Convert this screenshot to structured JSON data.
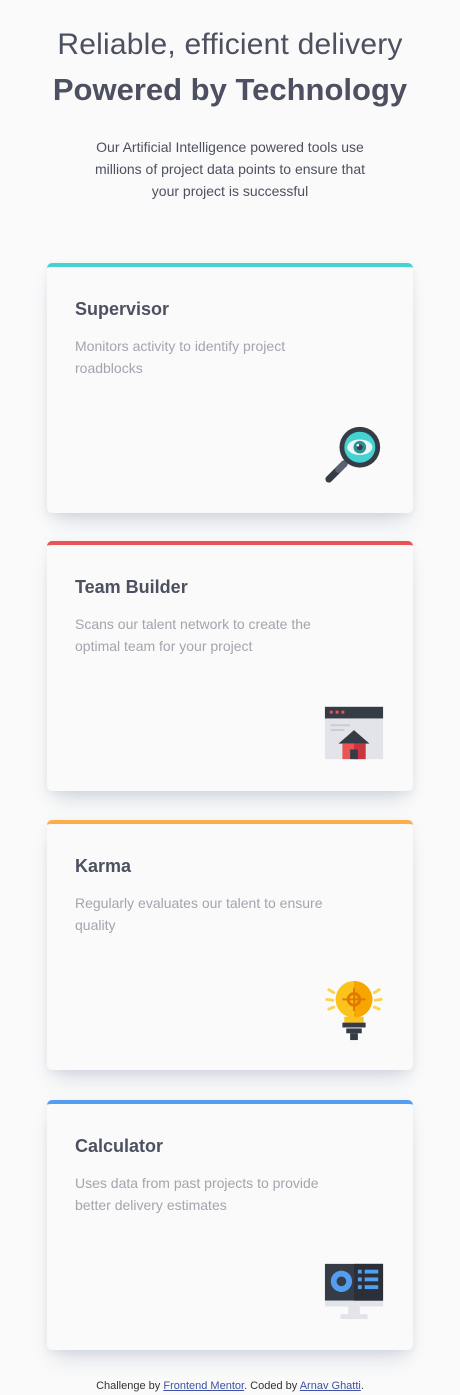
{
  "header": {
    "title_light": "Reliable, efficient delivery",
    "title_bold": "Powered by Technology",
    "subtitle": "Our Artificial Intelligence powered tools use millions of project data points to ensure that your project is successful"
  },
  "cards": [
    {
      "title": "Supervisor",
      "description": "Monitors activity to identify project roadblocks",
      "accent": "#44d3d2",
      "icon": "magnifier-eye-icon"
    },
    {
      "title": "Team Builder",
      "description": "Scans our talent network to create the optimal team for your project",
      "accent": "#ea5454",
      "icon": "browser-house-icon"
    },
    {
      "title": "Karma",
      "description": "Regularly evaluates our talent to ensure quality",
      "accent": "#fcae4a",
      "icon": "lightbulb-icon"
    },
    {
      "title": "Calculator",
      "description": "Uses data from past projects to provide better delivery estimates",
      "accent": "#549ef2",
      "icon": "monitor-chart-icon"
    }
  ],
  "footer": {
    "prefix": "Challenge by",
    "link1": "Frontend Mentor",
    "middle": ". Coded by",
    "link2": "Arnav Ghatti",
    "suffix": "."
  }
}
